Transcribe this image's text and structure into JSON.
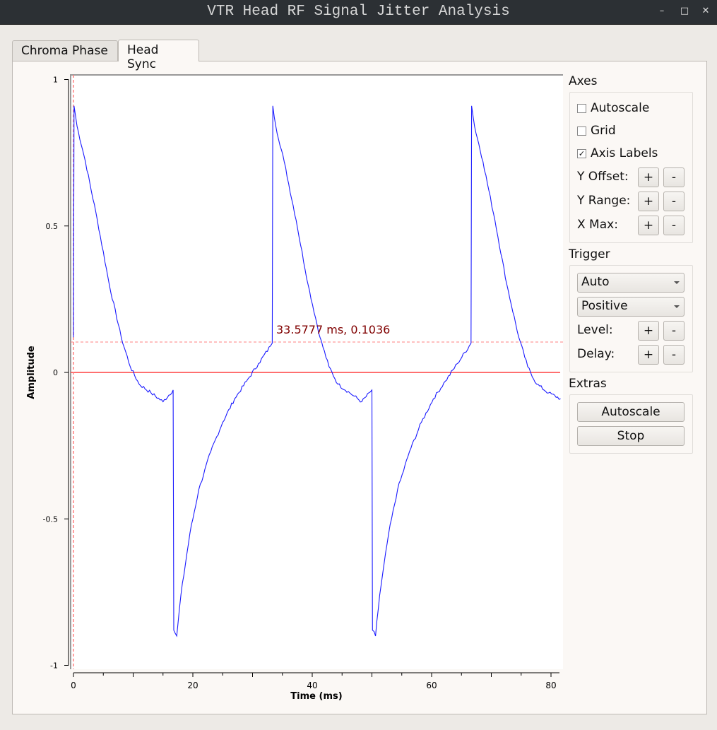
{
  "window": {
    "title": "VTR Head RF Signal Jitter Analysis"
  },
  "tabs": [
    {
      "label": "Chroma Phase"
    },
    {
      "label": "Head Sync"
    }
  ],
  "axes": {
    "label": "Axes",
    "autoscale": "Autoscale",
    "autoscale_checked": false,
    "grid": "Grid",
    "grid_checked": false,
    "axis_labels": "Axis Labels",
    "axis_labels_checked": true,
    "y_offset": "Y Offset:",
    "y_range": "Y Range:",
    "x_max": "X Max:",
    "plus": "+",
    "minus": "-"
  },
  "trigger": {
    "label": "Trigger",
    "mode": "Auto",
    "slope": "Positive",
    "level": "Level:",
    "delay": "Delay:"
  },
  "extras": {
    "label": "Extras",
    "autoscale": "Autoscale",
    "stop": "Stop"
  },
  "chart_data": {
    "type": "line",
    "xlabel": "Time (ms)",
    "ylabel": "Amplitude",
    "xlim": [
      0,
      82
    ],
    "ylim": [
      -1,
      1
    ],
    "xticks": [
      "0",
      "20",
      "40",
      "60",
      "80"
    ],
    "yticks": [
      "1",
      "0.5",
      "0",
      "-0.5",
      "-1"
    ],
    "grid": false,
    "series": [
      {
        "name": "Head Sync",
        "color": "#1a1aff",
        "x": [
          0,
          0.1,
          0.6,
          2,
          4,
          6,
          8,
          9.5,
          11,
          13,
          15,
          16.7,
          16.8,
          17.3,
          18,
          19.5,
          21,
          23,
          25,
          27,
          29,
          31,
          33,
          33.3,
          33.4,
          33.9,
          35.3,
          37.3,
          39.3,
          41.3,
          42.8,
          44.3,
          46.3,
          48.3,
          50,
          50.1,
          50.6,
          51.3,
          52.8,
          54.3,
          56.3,
          58.3,
          60.3,
          62.3,
          64.3,
          66.3,
          66.6,
          66.7,
          67.2,
          68.6,
          70.6,
          72.6,
          74.6,
          76.1,
          77.6,
          79.6,
          81.6
        ],
        "y": [
          0.12,
          0.91,
          0.84,
          0.72,
          0.52,
          0.3,
          0.12,
          0.02,
          -0.04,
          -0.07,
          -0.1,
          -0.06,
          -0.88,
          -0.9,
          -0.76,
          -0.55,
          -0.4,
          -0.27,
          -0.17,
          -0.09,
          -0.03,
          0.03,
          0.09,
          0.1,
          0.91,
          0.84,
          0.72,
          0.52,
          0.3,
          0.12,
          0.02,
          -0.04,
          -0.07,
          -0.1,
          -0.06,
          -0.88,
          -0.9,
          -0.76,
          -0.55,
          -0.4,
          -0.27,
          -0.17,
          -0.09,
          -0.03,
          0.03,
          0.09,
          0.1,
          0.91,
          0.84,
          0.72,
          0.52,
          0.3,
          0.12,
          0.02,
          -0.04,
          -0.07,
          -0.09
        ]
      }
    ],
    "trigger_level": 0.1036,
    "zero_line": 0,
    "cursor_label": "33.5777 ms, 0.1036",
    "colors": {
      "trigger": "#ff8080",
      "zero": "#ff4040",
      "cursor_text": "#800000"
    }
  }
}
